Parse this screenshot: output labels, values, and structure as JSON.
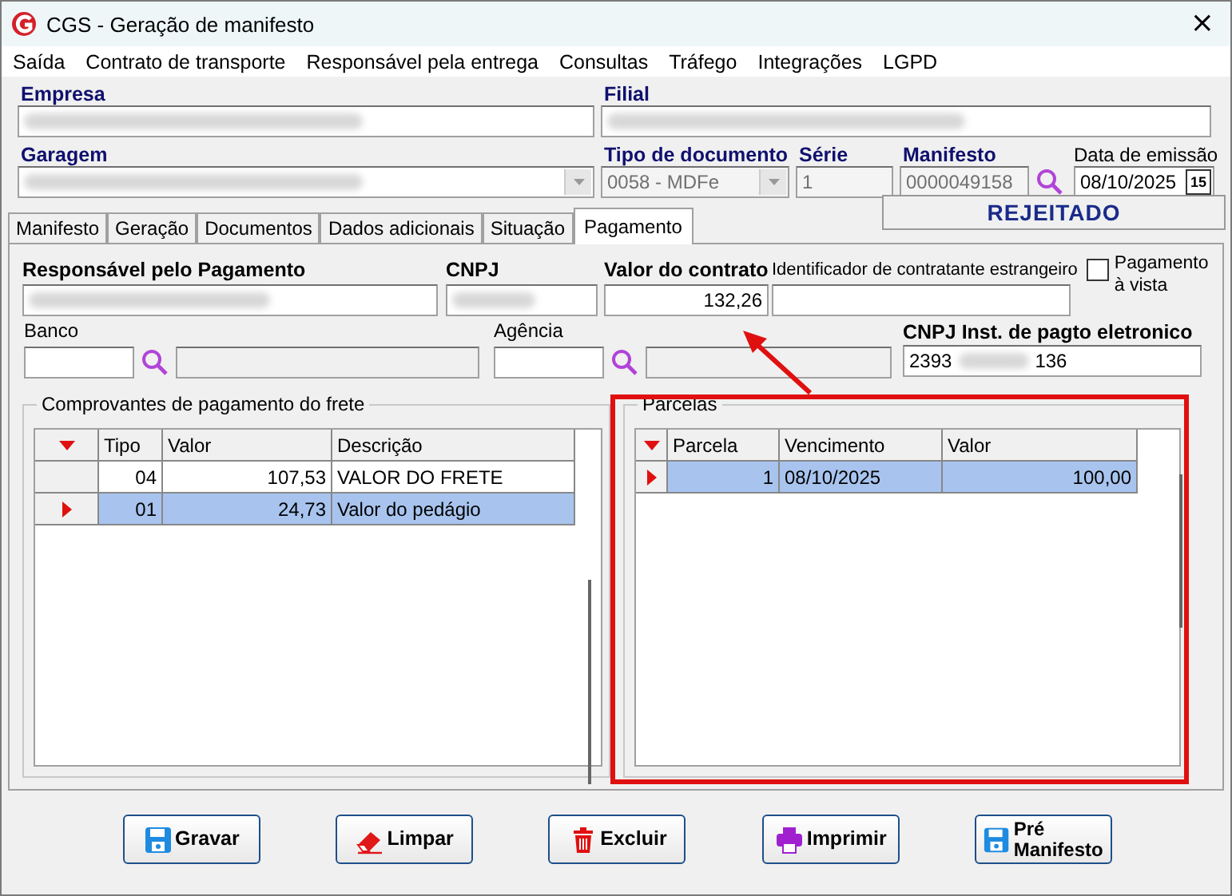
{
  "window": {
    "title": "CGS - Geração de manifesto",
    "close": "×"
  },
  "menu": [
    "Saída",
    "Contrato de transporte",
    "Responsável pela entrega",
    "Consultas",
    "Tráfego",
    "Integrações",
    "LGPD"
  ],
  "header": {
    "empresa": {
      "label": "Empresa",
      "redacted": true
    },
    "filial": {
      "label": "Filial",
      "redacted": true
    },
    "garagem": {
      "label": "Garagem",
      "redacted": true
    },
    "tipo_documento": {
      "label": "Tipo de documento",
      "value": "0058 - MDFe",
      "disabled": true
    },
    "serie": {
      "label": "Série",
      "value": "1",
      "disabled": true
    },
    "manifesto": {
      "label": "Manifesto",
      "value": "0000049158",
      "disabled": true
    },
    "data_emissao": {
      "label": "Data de emissão",
      "value": "08/10/2025",
      "button": "15"
    }
  },
  "status": "REJEITADO",
  "tabs": [
    {
      "label": "Manifesto",
      "selected": false
    },
    {
      "label": "Geração",
      "selected": false
    },
    {
      "label": "Documentos",
      "selected": false
    },
    {
      "label": "Dados adicionais",
      "selected": false
    },
    {
      "label": "Situação",
      "selected": false
    },
    {
      "label": "Pagamento",
      "selected": true
    }
  ],
  "payment": {
    "responsavel": {
      "label": "Responsável pelo Pagamento",
      "redacted": true
    },
    "cnpj": {
      "label": "CNPJ",
      "redacted": true
    },
    "valor_contrato": {
      "label": "Valor do contrato",
      "value": "132,26"
    },
    "identificador": {
      "label": "Identificador de contratante estrangeiro"
    },
    "pagamento_a_vista": {
      "label": "Pagamento à vista",
      "checked": false
    },
    "banco": {
      "label": "Banco"
    },
    "agencia": {
      "label": "Agência"
    },
    "cnpj_inst": {
      "label": "CNPJ Inst. de pagto eletronico",
      "value_parts": [
        "2393",
        "136"
      ]
    }
  },
  "comprovantes": {
    "title": "Comprovantes de pagamento do frete",
    "columns": [
      "Tipo",
      "Valor",
      "Descrição"
    ],
    "rows": [
      {
        "cells": [
          "04",
          "107,53",
          "VALOR DO FRETE"
        ],
        "selected": false
      },
      {
        "cells": [
          "01",
          "24,73",
          "Valor do pedágio"
        ],
        "selected": true
      }
    ]
  },
  "parcelas": {
    "title": "Parcelas",
    "columns": [
      "Parcela",
      "Vencimento",
      "Valor"
    ],
    "rows": [
      {
        "cells": [
          "1",
          "08/10/2025",
          "100,00"
        ],
        "selected": true
      }
    ]
  },
  "annotations": {
    "highlight_frame": true,
    "arrow": true
  },
  "buttons": [
    {
      "label": "Gravar",
      "kind": "save"
    },
    {
      "label": "Limpar",
      "kind": "eraser"
    },
    {
      "label": "Excluir",
      "kind": "trash"
    },
    {
      "label": "Imprimir",
      "kind": "print"
    },
    {
      "label": "Pré Manifesto",
      "kind": "save"
    }
  ]
}
